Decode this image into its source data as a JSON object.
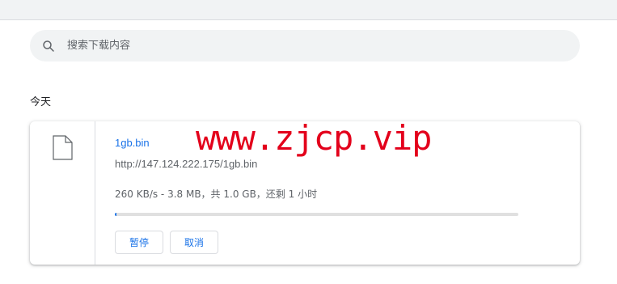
{
  "search": {
    "placeholder": "搜索下载内容",
    "value": ""
  },
  "section": {
    "title": "今天"
  },
  "download": {
    "filename": "1gb.bin",
    "url": "http://147.124.222.175/1gb.bin",
    "status": "260 KB/s - 3.8 MB，共 1.0 GB，还剩 1 小时",
    "progress_fraction": 0.0038,
    "pause_label": "暂停",
    "cancel_label": "取消"
  },
  "watermark": {
    "text": "www.zjcp.vip"
  },
  "colors": {
    "accent": "#1a73e8",
    "watermark": "#e3001b"
  }
}
